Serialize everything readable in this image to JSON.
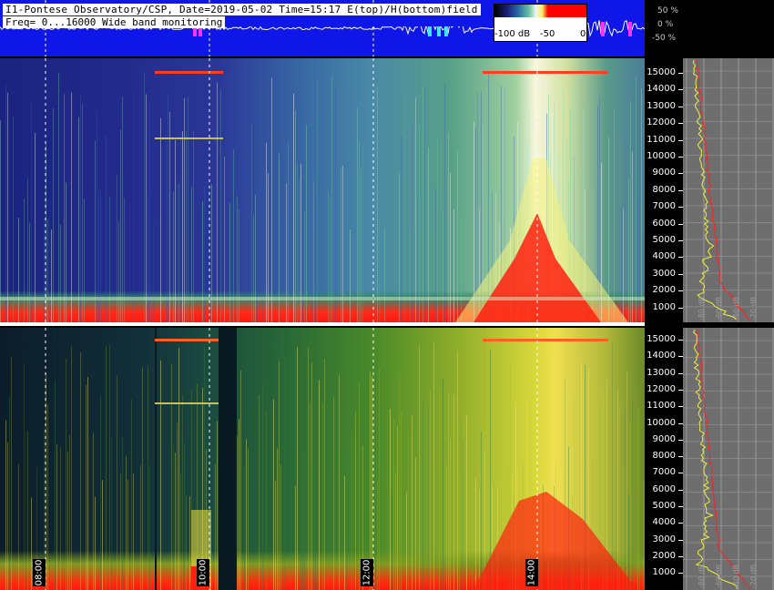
{
  "header": {
    "title": "I1-Pontese Observatory/CSP, Date=2019-05-02 Time=15:17 E(top)/H(bottom)field",
    "freq": "Freq= 0...16000 Wide band monitoring"
  },
  "colorbar": {
    "labels": [
      "-100 dB",
      "-50",
      "0"
    ]
  },
  "amplitude_scale": [
    "50 %",
    "0 %",
    "-50 %"
  ],
  "time_labels": [
    "08:00",
    "10:00",
    "12:00",
    "14:00"
  ],
  "freq_ticks": [
    "15000",
    "14000",
    "13000",
    "12000",
    "11000",
    "10000",
    "9000",
    "8000",
    "7000",
    "6000",
    "5000",
    "4000",
    "3000",
    "2000",
    "1000"
  ],
  "db_labels": [
    "-80 dB",
    "-60 dB",
    "-40 dB",
    "-20 dB"
  ],
  "colors": {
    "background": "#000000",
    "strip_blue": "#0f16e8",
    "spectrum_red": "#ff2010",
    "spectrum_yellow": "#f0f040",
    "marker_white": "#ffffff",
    "side_panel_gray": "#6e6e6e"
  }
}
